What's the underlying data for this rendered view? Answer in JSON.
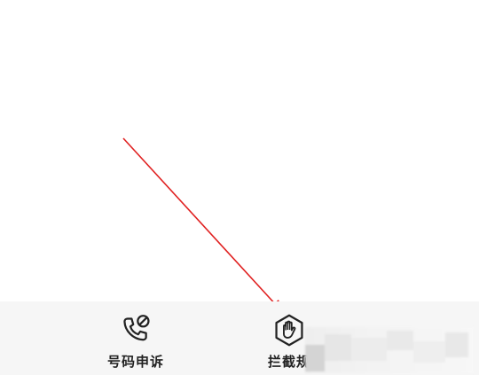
{
  "bottom_nav": {
    "tabs": [
      {
        "label": "号码申诉",
        "icon": "phone-blocked-icon"
      },
      {
        "label": "拦截规",
        "icon": "hand-stop-icon"
      }
    ]
  },
  "colors": {
    "annotation_arrow": "#e02020",
    "bottom_bar": "#f6f6f6",
    "icon_stroke": "#222222"
  }
}
